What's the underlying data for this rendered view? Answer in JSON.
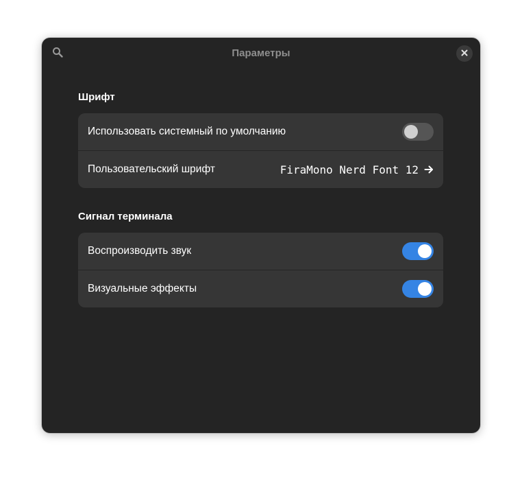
{
  "window": {
    "title": "Параметры"
  },
  "icons": {
    "search": "search-icon",
    "close": "close-icon",
    "arrow": "arrow-right-icon"
  },
  "colors": {
    "accent": "#3584e4",
    "window_bg": "#242424",
    "card_bg": "#363636",
    "title_text": "#8e8e8e"
  },
  "font_group": {
    "title": "Шрифт",
    "system_default": {
      "label": "Использовать системный по умолчанию",
      "enabled": false
    },
    "custom_font": {
      "label": "Пользовательский шрифт",
      "value": "FiraMono Nerd Font 12"
    }
  },
  "bell_group": {
    "title": "Сигнал терминала",
    "play_sound": {
      "label": "Воспроизводить звук",
      "enabled": true
    },
    "visual_effects": {
      "label": "Визуальные эффекты",
      "enabled": true
    }
  }
}
